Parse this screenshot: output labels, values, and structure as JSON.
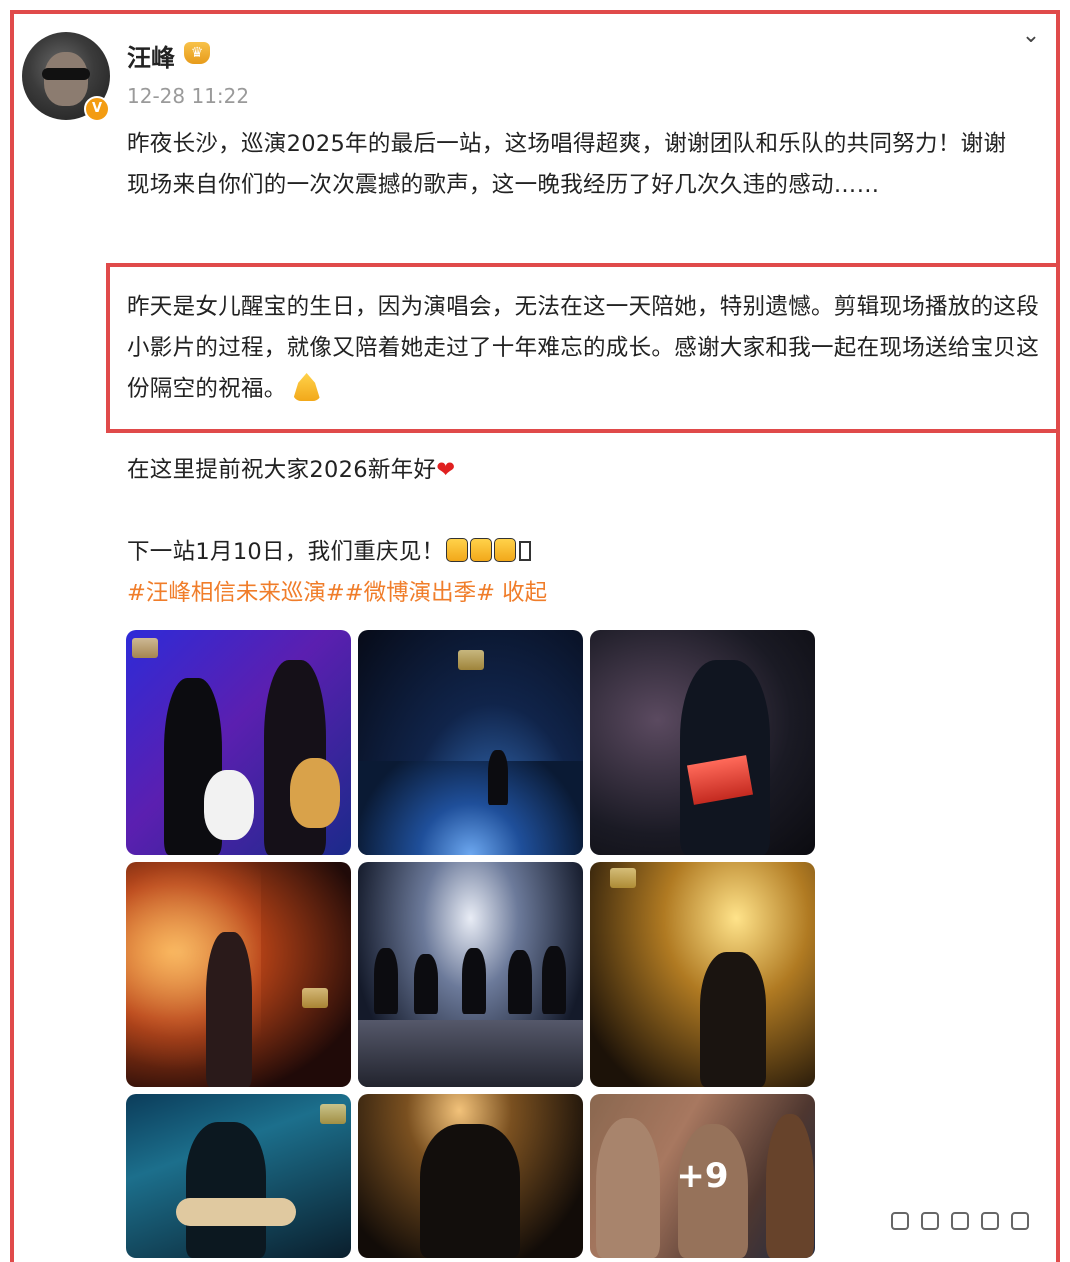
{
  "post": {
    "author": "汪峰",
    "timestamp": "12-28 11:22",
    "paragraph1": "昨夜长沙，巡演2025年的最后一站，这场唱得超爽，谢谢团队和乐队的共同努力！谢谢现场来自你们的一次次震撼的歌声，这一晚我经历了好几次久违的感动……",
    "paragraph2": "昨天是女儿醒宝的生日，因为演唱会，无法在这一天陪她，特别遗憾。剪辑现场播放的这段小影片的过程，就像又陪着她走过了十年难忘的成长。感谢大家和我一起在现场送给宝贝这份隔空的祝福。",
    "paragraph3": "在这里提前祝大家2026新年好",
    "paragraph4": "下一站1月10日，我们重庆见！",
    "hashtag1": "#汪峰相信未来巡演#",
    "hashtag2": "#微博演出季#",
    "collapse_link": "收起",
    "photo_more_count": "+9"
  },
  "icons": {
    "collapse": "chevron-down-icon",
    "verified": "verified-badge-icon",
    "crown": "crown-icon",
    "pray": "pray-emoji",
    "heart": "heart-emoji"
  },
  "colors": {
    "highlight_border": "#e04a4a",
    "hashtag": "#f07d2a",
    "timestamp": "#9a9a9a"
  }
}
